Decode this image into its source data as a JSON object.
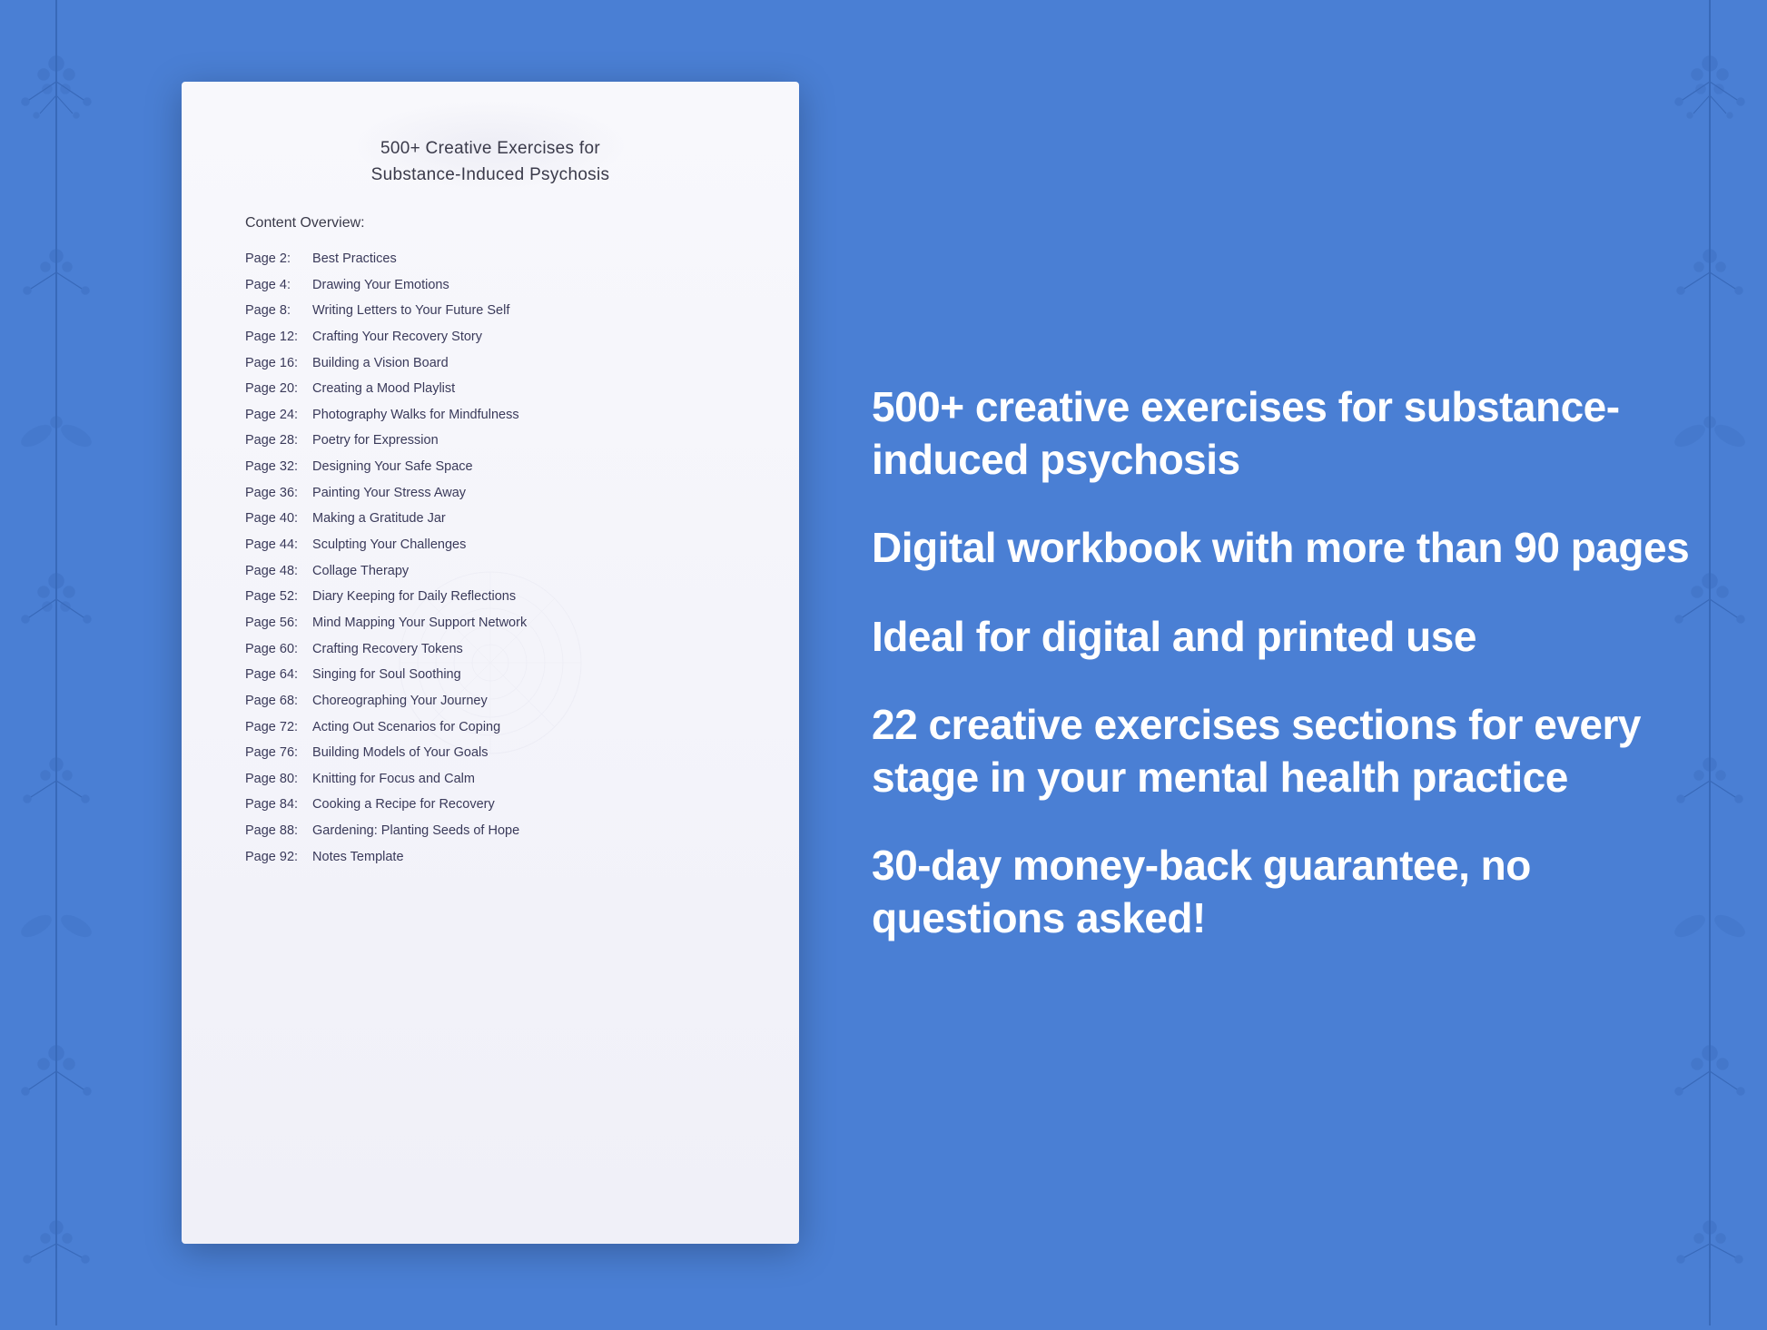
{
  "background_color": "#4a7fd4",
  "document": {
    "title_line1": "500+ Creative Exercises for",
    "title_line2": "Substance-Induced Psychosis",
    "section_label": "Content Overview:",
    "toc_entries": [
      {
        "page": "Page  2:",
        "title": "Best Practices"
      },
      {
        "page": "Page  4:",
        "title": "Drawing Your Emotions"
      },
      {
        "page": "Page  8:",
        "title": "Writing Letters to Your Future Self"
      },
      {
        "page": "Page 12:",
        "title": "Crafting Your Recovery Story"
      },
      {
        "page": "Page 16:",
        "title": "Building a Vision Board"
      },
      {
        "page": "Page 20:",
        "title": "Creating a Mood Playlist"
      },
      {
        "page": "Page 24:",
        "title": "Photography Walks for Mindfulness"
      },
      {
        "page": "Page 28:",
        "title": "Poetry for Expression"
      },
      {
        "page": "Page 32:",
        "title": "Designing Your Safe Space"
      },
      {
        "page": "Page 36:",
        "title": "Painting Your Stress Away"
      },
      {
        "page": "Page 40:",
        "title": "Making a Gratitude Jar"
      },
      {
        "page": "Page 44:",
        "title": "Sculpting Your Challenges"
      },
      {
        "page": "Page 48:",
        "title": "Collage Therapy"
      },
      {
        "page": "Page 52:",
        "title": "Diary Keeping for Daily Reflections"
      },
      {
        "page": "Page 56:",
        "title": "Mind Mapping Your Support Network"
      },
      {
        "page": "Page 60:",
        "title": "Crafting Recovery Tokens"
      },
      {
        "page": "Page 64:",
        "title": "Singing for Soul Soothing"
      },
      {
        "page": "Page 68:",
        "title": "Choreographing Your Journey"
      },
      {
        "page": "Page 72:",
        "title": "Acting Out Scenarios for Coping"
      },
      {
        "page": "Page 76:",
        "title": "Building Models of Your Goals"
      },
      {
        "page": "Page 80:",
        "title": "Knitting for Focus and Calm"
      },
      {
        "page": "Page 84:",
        "title": "Cooking a Recipe for Recovery"
      },
      {
        "page": "Page 88:",
        "title": "Gardening: Planting Seeds of Hope"
      },
      {
        "page": "Page 92:",
        "title": "Notes Template"
      }
    ]
  },
  "features": [
    "500+ creative exercises for substance-induced psychosis",
    "Digital workbook with more than 90 pages",
    "Ideal for digital and printed use",
    "22 creative exercises sections for every stage in your mental health practice",
    "30-day money-back guarantee, no questions asked!"
  ]
}
